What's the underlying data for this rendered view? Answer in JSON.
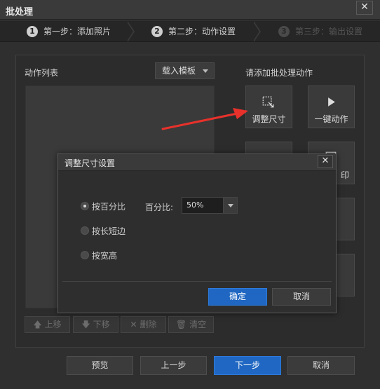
{
  "window": {
    "title": "批处理",
    "close_glyph": "✕"
  },
  "steps": [
    {
      "num": "1",
      "label": "第一步：添加照片",
      "active": false
    },
    {
      "num": "2",
      "label": "第二步：动作设置",
      "active": true
    },
    {
      "num": "3",
      "label": "第三步：输出设置",
      "active": false
    }
  ],
  "left_panel": {
    "title": "动作列表",
    "load_template_label": "载入模板"
  },
  "right_panel": {
    "title": "请添加批处理动作",
    "tiles": [
      {
        "label": "调整尺寸",
        "icon": "resize-icon"
      },
      {
        "label": "一键动作",
        "icon": "play-icon"
      },
      {
        "label": "",
        "icon": ""
      },
      {
        "label": "印",
        "icon": "watermark-icon"
      }
    ]
  },
  "list_buttons": {
    "up": "上移",
    "down": "下移",
    "delete": "删除",
    "clear": "清空"
  },
  "footer": {
    "preview": "预览",
    "prev": "上一步",
    "next": "下一步",
    "cancel": "取消"
  },
  "dialog": {
    "title": "调整尺寸设置",
    "close_glyph": "✕",
    "options": [
      {
        "label": "按百分比",
        "checked": true
      },
      {
        "label": "按长短边",
        "checked": false
      },
      {
        "label": "按宽高",
        "checked": false
      }
    ],
    "percent_label": "百分比:",
    "percent_value": "50%",
    "ok": "确定",
    "cancel": "取消"
  },
  "colors": {
    "accent": "#1f67c2",
    "arrow": "#e8312b"
  }
}
